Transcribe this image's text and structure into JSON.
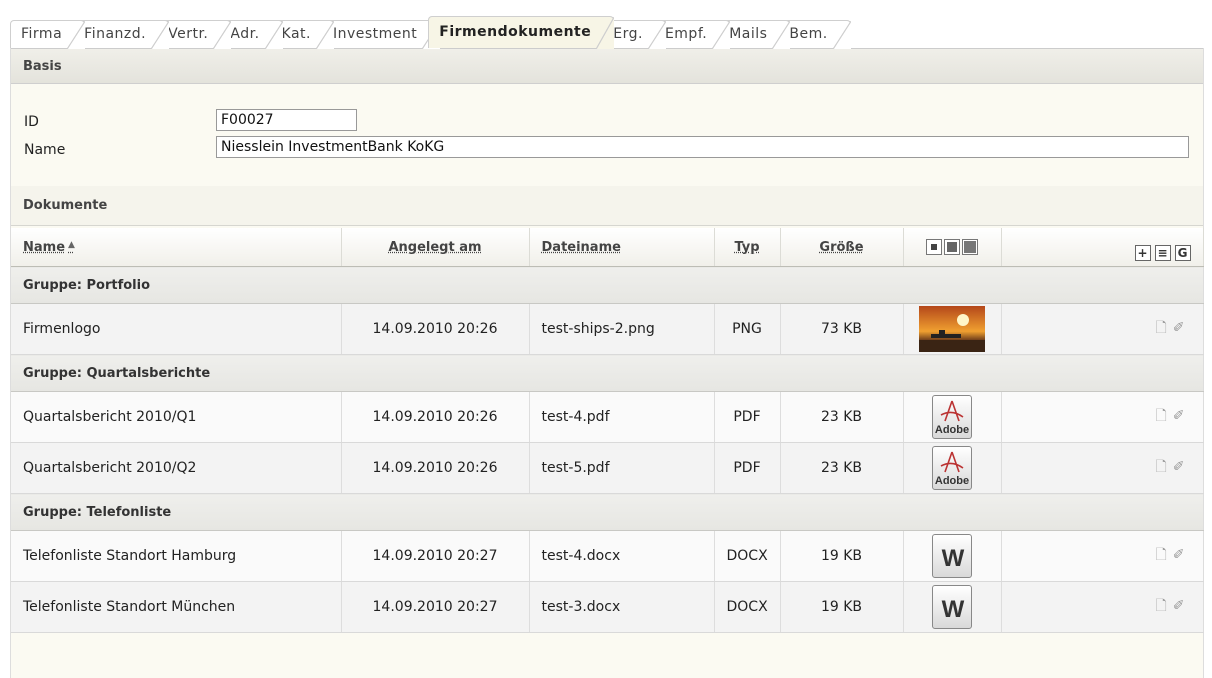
{
  "tabs": [
    {
      "label": "Firma",
      "active": false
    },
    {
      "label": "Finanzd.",
      "active": false
    },
    {
      "label": "Vertr.",
      "active": false
    },
    {
      "label": "Adr.",
      "active": false
    },
    {
      "label": "Kat.",
      "active": false
    },
    {
      "label": "Investment",
      "active": false
    },
    {
      "label": "Firmendokumente",
      "active": true
    },
    {
      "label": "Erg.",
      "active": false
    },
    {
      "label": "Empf.",
      "active": false
    },
    {
      "label": "Mails",
      "active": false
    },
    {
      "label": "Bem.",
      "active": false
    }
  ],
  "basis": {
    "title": "Basis",
    "id_label": "ID",
    "id_value": "F00027",
    "name_label": "Name",
    "name_value": "Niesslein InvestmentBank KoKG"
  },
  "documents": {
    "title": "Dokumente",
    "columns": {
      "name": "Name",
      "created": "Angelegt am",
      "filename": "Dateiname",
      "type": "Typ",
      "size": "Größe"
    },
    "sort_indicator": "▲",
    "groups": [
      {
        "label": "Gruppe: Portfolio",
        "rows": [
          {
            "name": "Firmenlogo",
            "created": "14.09.2010 20:26",
            "filename": "test-ships-2.png",
            "type": "PNG",
            "size": "73 KB",
            "preview": "image-thumbnail"
          }
        ]
      },
      {
        "label": "Gruppe: Quartalsberichte",
        "rows": [
          {
            "name": "Quartalsbericht 2010/Q1",
            "created": "14.09.2010 20:26",
            "filename": "test-4.pdf",
            "type": "PDF",
            "size": "23 KB",
            "preview": "adobe-pdf-icon",
            "icon_text": "Adobe"
          },
          {
            "name": "Quartalsbericht 2010/Q2",
            "created": "14.09.2010 20:26",
            "filename": "test-5.pdf",
            "type": "PDF",
            "size": "23 KB",
            "preview": "adobe-pdf-icon",
            "icon_text": "Adobe"
          }
        ]
      },
      {
        "label": "Gruppe: Telefonliste",
        "rows": [
          {
            "name": "Telefonliste Standort Hamburg",
            "created": "14.09.2010 20:27",
            "filename": "test-4.docx",
            "type": "DOCX",
            "size": "19 KB",
            "preview": "word-doc-icon",
            "icon_text": "W"
          },
          {
            "name": "Telefonliste Standort München",
            "created": "14.09.2010 20:27",
            "filename": "test-3.docx",
            "type": "DOCX",
            "size": "19 KB",
            "preview": "word-doc-icon",
            "icon_text": "W"
          }
        ]
      }
    ],
    "row_actions": [
      "document-icon",
      "edit-pen-icon"
    ],
    "header_tools": [
      "add-plus-icon",
      "list-view-icon",
      "group-g-icon"
    ],
    "view_sizes": [
      "small-thumbnail-icon",
      "medium-thumbnail-icon",
      "large-thumbnail-icon"
    ]
  }
}
